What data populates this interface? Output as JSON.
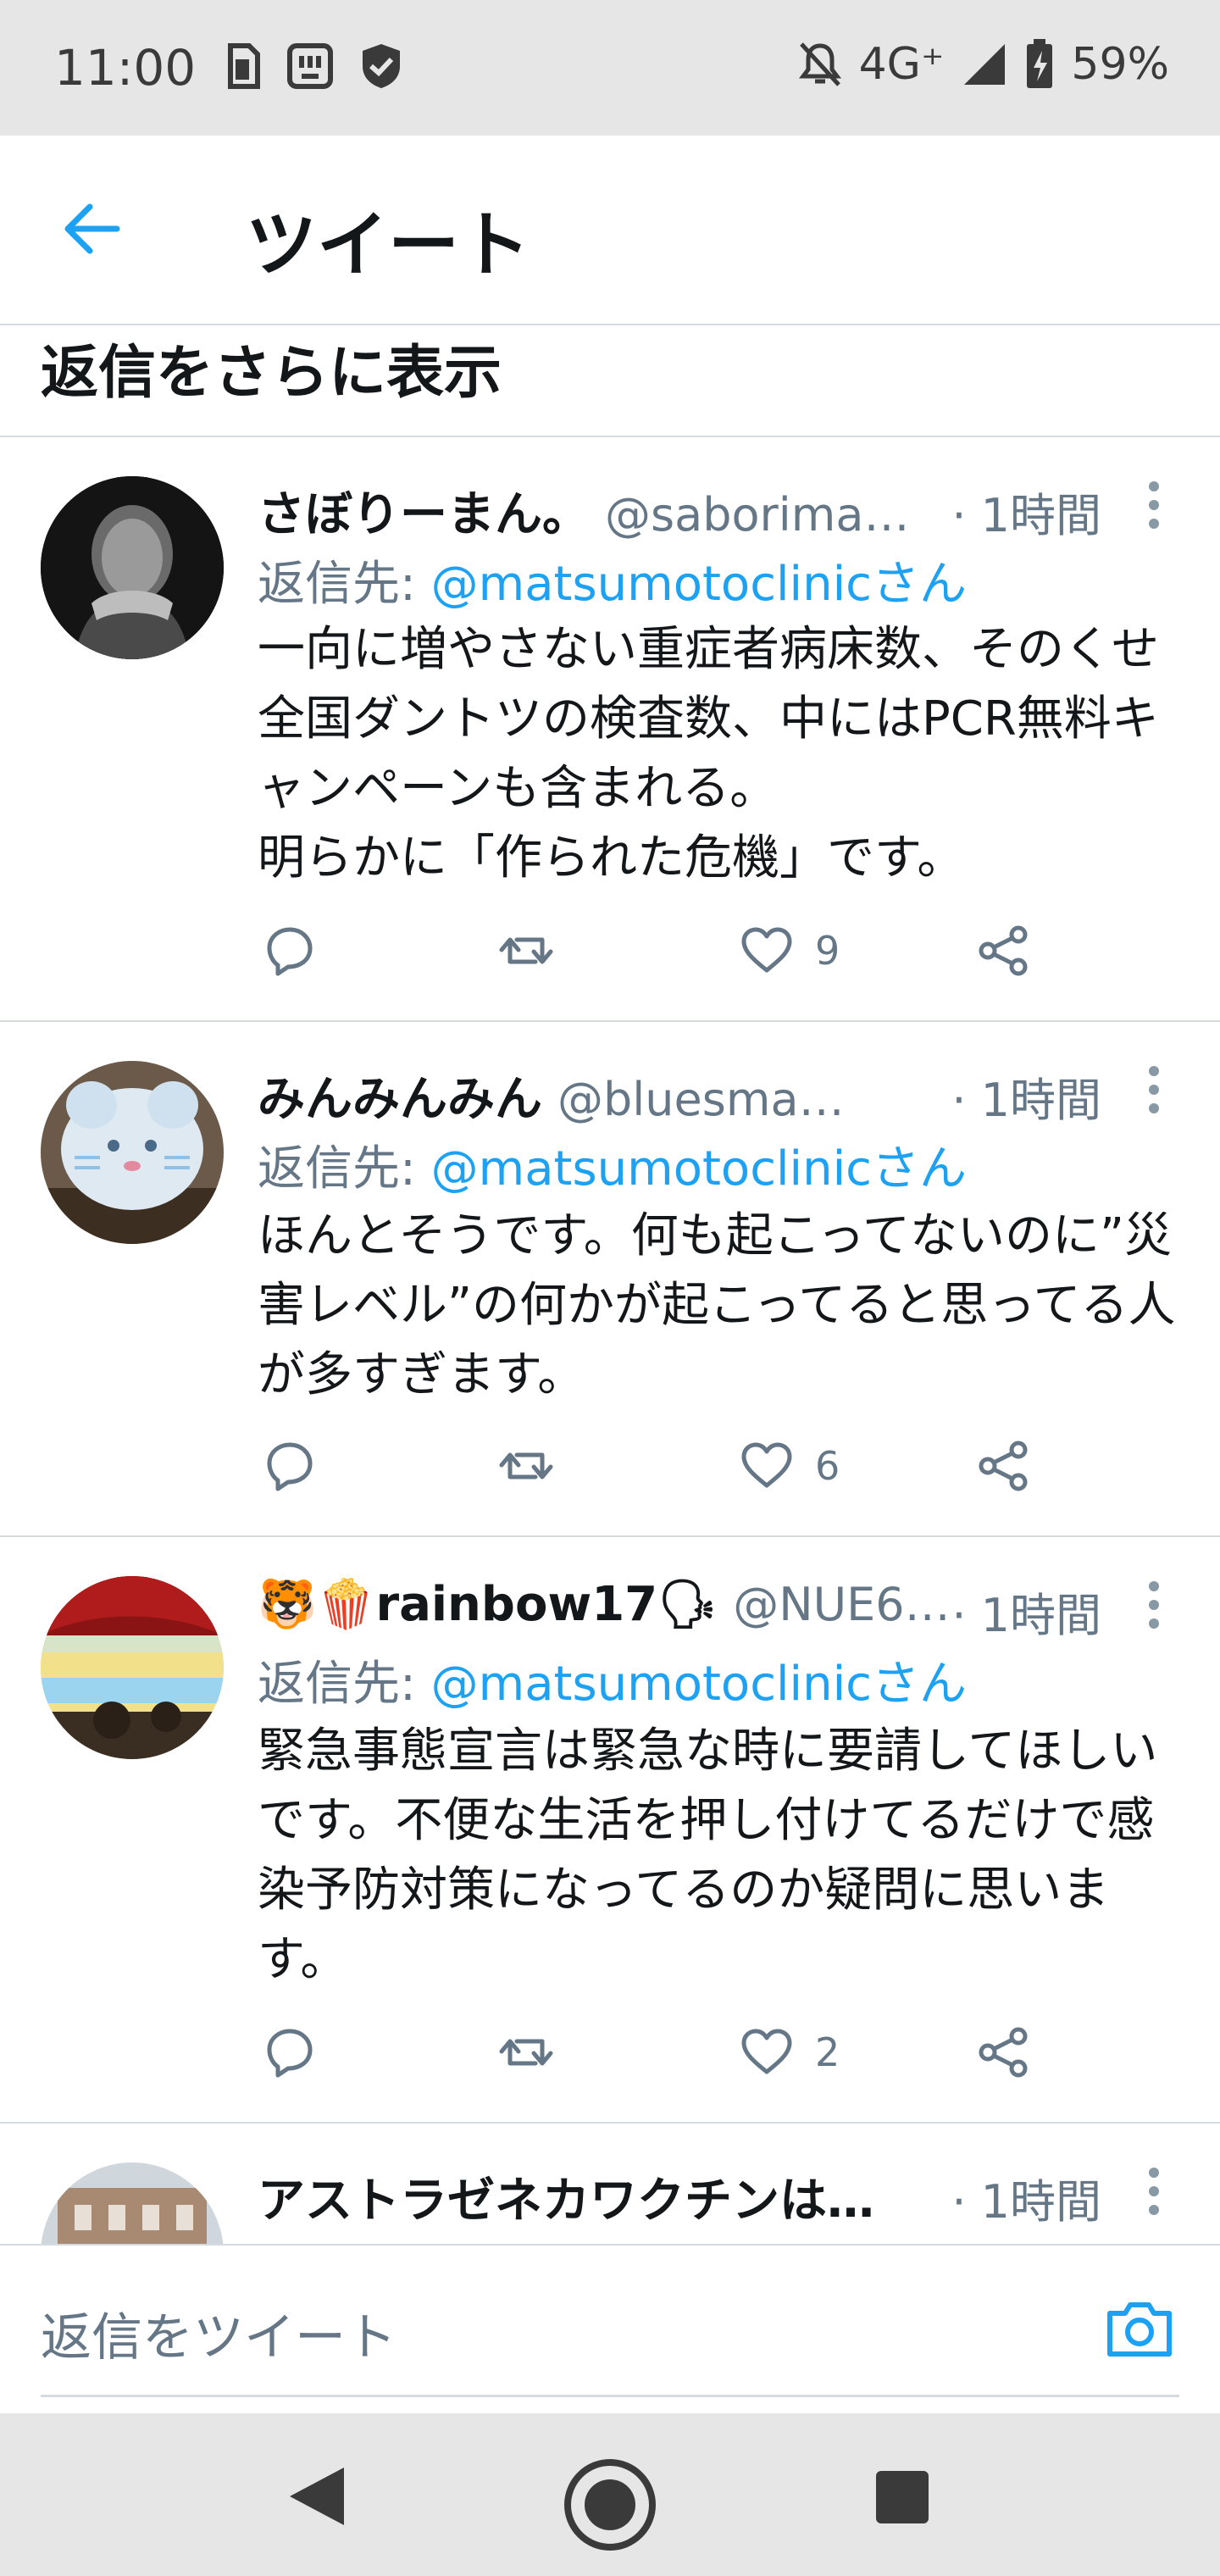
{
  "status_bar": {
    "time": "11:00",
    "network": "4G⁺",
    "battery": "59%",
    "icons": [
      "sim-card-icon",
      "notification-app-icon",
      "shield-icon",
      "bell-off-icon",
      "signal-icon",
      "battery-charging-icon"
    ]
  },
  "header": {
    "back_icon": "arrow-left-icon",
    "title": "ツイート"
  },
  "more_replies": "返信をさらに表示",
  "colors": {
    "accent": "#1da1f2",
    "secondary_text": "#657786",
    "divider": "#d6dbdf",
    "system_bar": "#e6e6e6"
  },
  "tweets": [
    {
      "display_name": "さぼりーまん。",
      "handle": "@saborima…",
      "time": "· 1時間",
      "reply_prefix": "返信先: ",
      "reply_handle": "@matsumotoclinicさん",
      "text": "一向に増やさない重症者病床数、そのくせ全国ダントツの検査数、中にはPCR無料キャンペーンも含まれる。\n明らかに「作られた危機」です。",
      "likes": "9"
    },
    {
      "display_name": "みんみんみん",
      "handle": "@bluesman1…",
      "time": "· 1時間",
      "reply_prefix": "返信先: ",
      "reply_handle": "@matsumotoclinicさん",
      "text": "ほんとそうです。何も起こってないのに”災害レベル”の何かが起こってると思ってる人が多すぎます。",
      "likes": "6"
    },
    {
      "display_name": "🐯🍿rainbow17🗣",
      "handle": "@NUE6…",
      "time": "· 1時間",
      "reply_prefix": "返信先: ",
      "reply_handle": "@matsumotoclinicさん",
      "text": "緊急事態宣言は緊急な時に要請してほしいです。不便な生活を押し付けてるだけで感染予防対策になってるのか疑問に思います。",
      "likes": "2"
    },
    {
      "display_name": "アストラゼネカワクチンは…",
      "time": "· 1時間"
    }
  ],
  "composer": {
    "placeholder": "返信をツイート",
    "camera_icon": "camera-icon"
  },
  "nav_bar": {
    "icons": [
      "nav-back-icon",
      "nav-home-icon",
      "nav-recents-icon"
    ]
  }
}
